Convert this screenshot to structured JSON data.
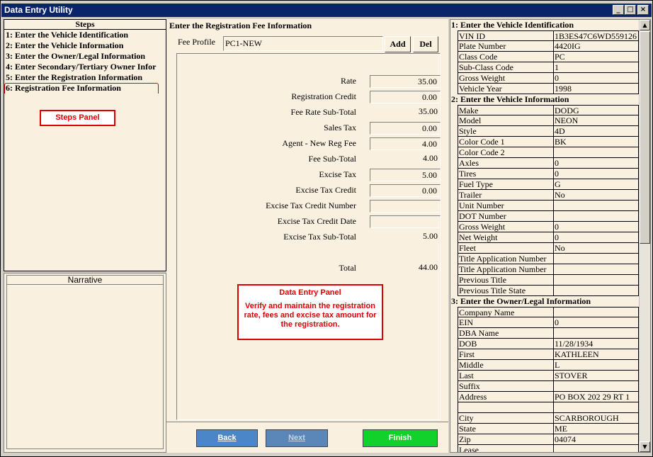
{
  "window": {
    "title": "Data Entry Utility",
    "controls": [
      "_",
      "□",
      "×"
    ]
  },
  "steps": {
    "header": "Steps",
    "items": [
      {
        "label": "1: Enter the Vehicle Identification"
      },
      {
        "label": "2: Enter the Vehicle Information"
      },
      {
        "label": "3: Enter the Owner/Legal Information"
      },
      {
        "label": "4: Enter  Secondary/Tertiary Owner Infor"
      },
      {
        "label": "5: Enter the Registration Information"
      },
      {
        "label": "6: Registration Fee Information"
      }
    ],
    "selected_index": 5,
    "callout": "Steps Panel"
  },
  "narrative": {
    "header": "Narrative"
  },
  "main": {
    "title": "Enter the Registration Fee Information",
    "fee_profile_label": "Fee Profile",
    "fee_profile_value": "PC1-NEW",
    "add_label": "Add",
    "del_label": "Del",
    "rows": [
      {
        "label": "Rate",
        "value": "35.00",
        "kind": "field"
      },
      {
        "label": "Registration Credit",
        "value": "0.00",
        "kind": "field"
      },
      {
        "label": "Fee Rate Sub-Total",
        "value": "35.00",
        "kind": "static"
      },
      {
        "label": "Sales Tax",
        "value": "0.00",
        "kind": "field"
      },
      {
        "label": "Agent - New Reg Fee",
        "value": "4.00",
        "kind": "field"
      },
      {
        "label": "Fee Sub-Total",
        "value": "4.00",
        "kind": "static"
      },
      {
        "label": "Excise Tax",
        "value": "5.00",
        "kind": "field"
      },
      {
        "label": "Excise Tax Credit",
        "value": "0.00",
        "kind": "field"
      },
      {
        "label": "Excise Tax Credit Number",
        "value": "",
        "kind": "field"
      },
      {
        "label": "Excise Tax Credit Date",
        "value": "",
        "kind": "field"
      },
      {
        "label": "Excise Tax Sub-Total",
        "value": "5.00",
        "kind": "static"
      },
      {
        "label": "Total",
        "value": "44.00",
        "kind": "static"
      }
    ],
    "callout_title": "Data Entry Panel",
    "callout_body": "Verify and maintain the registration rate, fees and excise tax amount for the registration.",
    "back_label": "Back",
    "next_label": "Next",
    "finish_label": "Finish"
  },
  "colors": {
    "finish": "#12d12a",
    "back": "#4a86c8",
    "next": "#5a86b8",
    "callout": "#dd0000"
  },
  "summary": {
    "sections": [
      {
        "title": "1: Enter the Vehicle Identification",
        "rows": [
          [
            "VIN ID",
            "1B3ES47C6WD559126"
          ],
          [
            "Plate Number",
            "4420IG"
          ],
          [
            "Class Code",
            "PC"
          ],
          [
            "Sub-Class Code",
            "1"
          ],
          [
            "Gross Weight",
            "0"
          ],
          [
            "Vehicle Year",
            "1998"
          ]
        ]
      },
      {
        "title": "2: Enter the Vehicle Information",
        "rows": [
          [
            "Make",
            "DODG"
          ],
          [
            "Model",
            "NEON"
          ],
          [
            "Style",
            "4D"
          ],
          [
            "Color Code 1",
            "BK"
          ],
          [
            "Color Code 2",
            ""
          ],
          [
            "Axles",
            "0"
          ],
          [
            "Tires",
            "0"
          ],
          [
            "Fuel Type",
            "G"
          ],
          [
            "Trailer",
            "No"
          ],
          [
            "Unit Number",
            ""
          ],
          [
            "DOT Number",
            ""
          ],
          [
            "Gross Weight",
            "0"
          ],
          [
            "Net Weight",
            "0"
          ],
          [
            "Fleet",
            "No"
          ],
          [
            "Title Application Number",
            ""
          ],
          [
            "Title Application Number",
            ""
          ],
          [
            "Previous Title",
            ""
          ],
          [
            "Previous Title State",
            ""
          ]
        ]
      },
      {
        "title": "3: Enter the Owner/Legal Information",
        "rows": [
          [
            "Company  Name",
            ""
          ],
          [
            "EIN",
            "0"
          ],
          [
            "DBA Name",
            ""
          ],
          [
            "DOB",
            "11/28/1934"
          ],
          [
            "First",
            "KATHLEEN"
          ],
          [
            "Middle",
            "L"
          ],
          [
            "Last",
            "STOVER"
          ],
          [
            "Suffix",
            ""
          ],
          [
            "Address",
            "PO BOX 202 29 RT 1"
          ],
          [
            "",
            ""
          ],
          [
            "City",
            "SCARBOROUGH"
          ],
          [
            "State",
            "ME"
          ],
          [
            "Zip",
            "04074"
          ],
          [
            "Lease",
            ""
          ]
        ]
      }
    ]
  }
}
